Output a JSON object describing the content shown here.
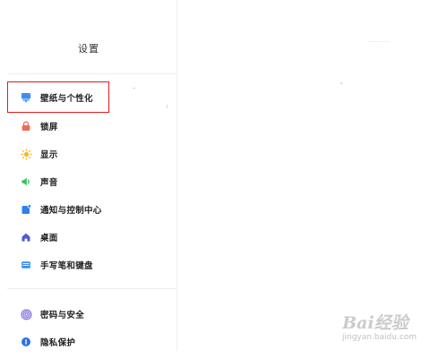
{
  "sidebar": {
    "title": "设置",
    "items": [
      {
        "label": "壁纸与个性化",
        "icon": "wallpaper-icon",
        "color": "#3f8cf2",
        "selected": true
      },
      {
        "label": "锁屏",
        "icon": "lock-icon",
        "color": "#ef6b57"
      },
      {
        "label": "显示",
        "icon": "sun-icon",
        "color": "#f5b72a"
      },
      {
        "label": "声音",
        "icon": "speaker-icon",
        "color": "#33c15e"
      },
      {
        "label": "通知与控制中心",
        "icon": "notification-icon",
        "color": "#2f80ed"
      },
      {
        "label": "桌面",
        "icon": "home-icon",
        "color": "#4e5bd6"
      },
      {
        "label": "手写笔和键盘",
        "icon": "keyboard-icon",
        "color": "#3b8ff0"
      },
      {
        "label": "密码与安全",
        "icon": "fingerprint-icon",
        "color": "#6a55d9"
      },
      {
        "label": "隐私保护",
        "icon": "privacy-icon",
        "color": "#2b73e6"
      }
    ]
  },
  "watermark": {
    "brand": "Bai经验",
    "url": "jingyan.baidu.com"
  },
  "colors": {
    "highlight": "#e21a1a",
    "divider": "#eeeeee"
  }
}
